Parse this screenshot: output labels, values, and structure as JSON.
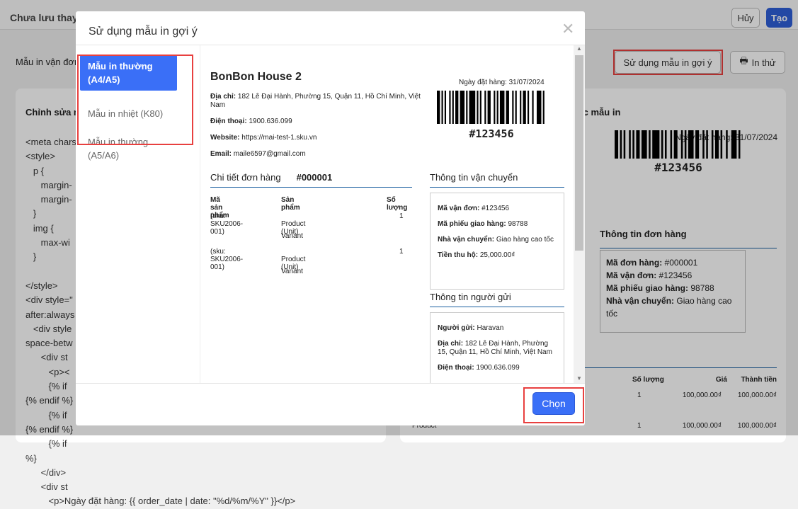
{
  "header": {
    "title": "Chưa lưu thay",
    "cancel_label": "Hủy",
    "create_label": "Tạo",
    "accent": "#2f5fd8"
  },
  "toolbar": {
    "title": "Mẫu in vận đơn",
    "suggest_label": "Sử dụng mẫu in gợi ý",
    "print_label": "In thử",
    "print_icon": "printer-icon"
  },
  "editor": {
    "title": "Chỉnh sửa m",
    "code_lines": [
      "<meta chars",
      "<style>",
      "   p {",
      "      margin-",
      "      margin-",
      "   }",
      "   img {",
      "      max-wi",
      "   }",
      "",
      "</style>",
      "<div style=\"",
      "after:always",
      "   <div style",
      "space-betw",
      "      <div st",
      "         <p><",
      "         {% if",
      "{% endif %}",
      "         {% if",
      "{% endif %}",
      "         {% if",
      "%}",
      "      </div>",
      "      <div st",
      "         <p>Ngày đặt hàng: {{ order_date | date: \"%d/%m/%Y\" }}</p>"
    ]
  },
  "preview_bg": {
    "title": "ước mẫu in",
    "order_date": "Ngày đặt hàng: 31/07/2024",
    "barcode": "#123456",
    "order_info_title": "Thông tin đơn hàng",
    "order_info": [
      [
        "Mã đơn hàng:",
        "#000001"
      ],
      [
        "Mã vận đơn:",
        "#123456"
      ],
      [
        "Mã phiếu giao hàng:",
        "98788"
      ],
      [
        "Nhà vận chuyển:",
        "Giao hàng cao tốc"
      ]
    ],
    "cols": [
      "Số lượng",
      "Giá",
      "Thành tiền"
    ],
    "rows": [
      {
        "name": "",
        "qty": "1",
        "price": "100,000.00₫",
        "total": "100,000.00₫"
      },
      {
        "name": "Product",
        "qty": "1",
        "price": "100,000.00₫",
        "total": "100,000.00₫"
      }
    ]
  },
  "modal": {
    "title": "Sử dụng mẫu in gợi ý",
    "close_icon": "close-icon",
    "menu": [
      {
        "label": "Mẫu in thường (A4/A5)",
        "selected": true
      },
      {
        "label": "Mẫu in nhiệt (K80)"
      },
      {
        "label": "Mẫu in thường (A5/A6)"
      }
    ],
    "choose_label": "Chọn",
    "preview": {
      "store": "BonBon House 2",
      "address_label": "Địa chỉ:",
      "address": "182 Lê Đại Hành, Phường 15, Quận 11, Hồ Chí Minh, Việt Nam",
      "phone_label": "Điện thoại:",
      "phone": "1900.636.099",
      "website_label": "Website:",
      "website": "https://mai-test-1.sku.vn",
      "email_label": "Email:",
      "email": "maile6597@gmail.com",
      "order_date": "Ngày đặt hàng: 31/07/2024",
      "barcode": "#123456",
      "detail_title": "Chi tiết đơn hàng",
      "order_no": "#000001",
      "cols": [
        "Mã sản phẩm",
        "Sản phẩm",
        "Số lượng"
      ],
      "items": [
        {
          "sku": "(sku: SKU2006-001)",
          "product": "Product (Unit)",
          "variant": "Variant",
          "qty": "1"
        },
        {
          "sku": "(sku: SKU2006-001)",
          "product": "Product (Unit)",
          "variant": "Variant",
          "qty": "1"
        }
      ],
      "shipping_title": "Thông tin vận chuyển",
      "shipping": [
        [
          "Mã vận đơn:",
          "#123456"
        ],
        [
          "Mã phiếu giao hàng:",
          "98788"
        ],
        [
          "Nhà vận chuyển:",
          "Giao hàng cao tốc"
        ],
        [
          "Tiền thu hộ:",
          "25,000.00₫"
        ]
      ],
      "sender_title": "Thông tin người gửi",
      "sender": [
        [
          "Người gửi:",
          "Haravan"
        ],
        [
          "Địa chỉ:",
          "182 Lê Đại Hành, Phường 15, Quận 11, Hồ Chí Minh, Việt Nam"
        ],
        [
          "Điện thoại:",
          "1900.636.099"
        ]
      ]
    }
  }
}
